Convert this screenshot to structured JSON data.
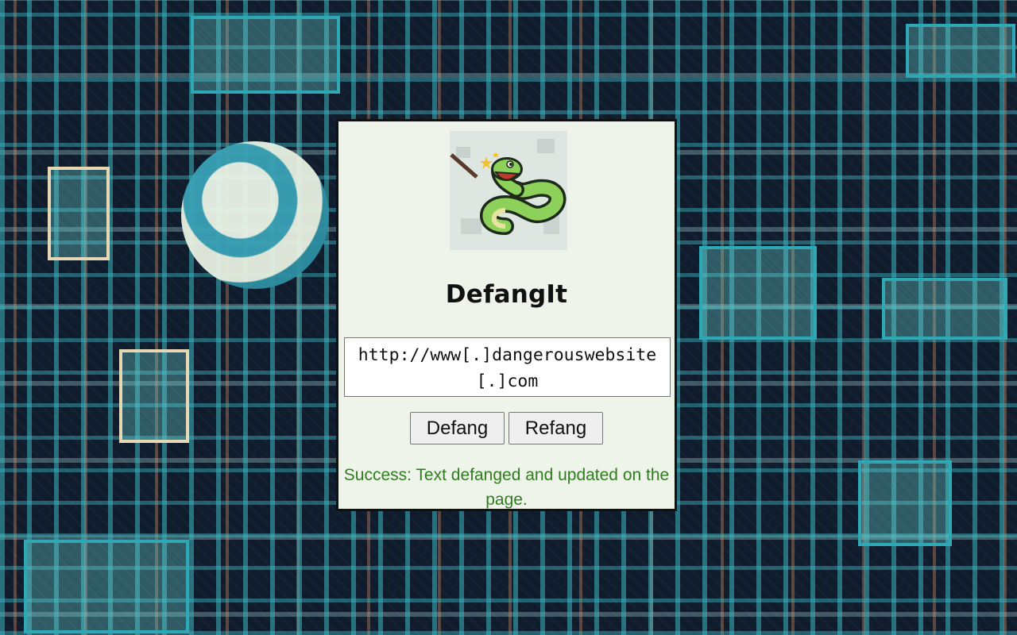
{
  "app": {
    "title": "DefangIt"
  },
  "editor": {
    "value": "http://www[.]dangerouswebsite[.]com"
  },
  "actions": {
    "defang_label": "Defang",
    "refang_label": "Refang"
  },
  "status": {
    "message": "Success: Text defanged and updated on the page.",
    "color": "#2f7d1e"
  },
  "logo": {
    "icon": "snake-with-magic-wand-icon"
  }
}
